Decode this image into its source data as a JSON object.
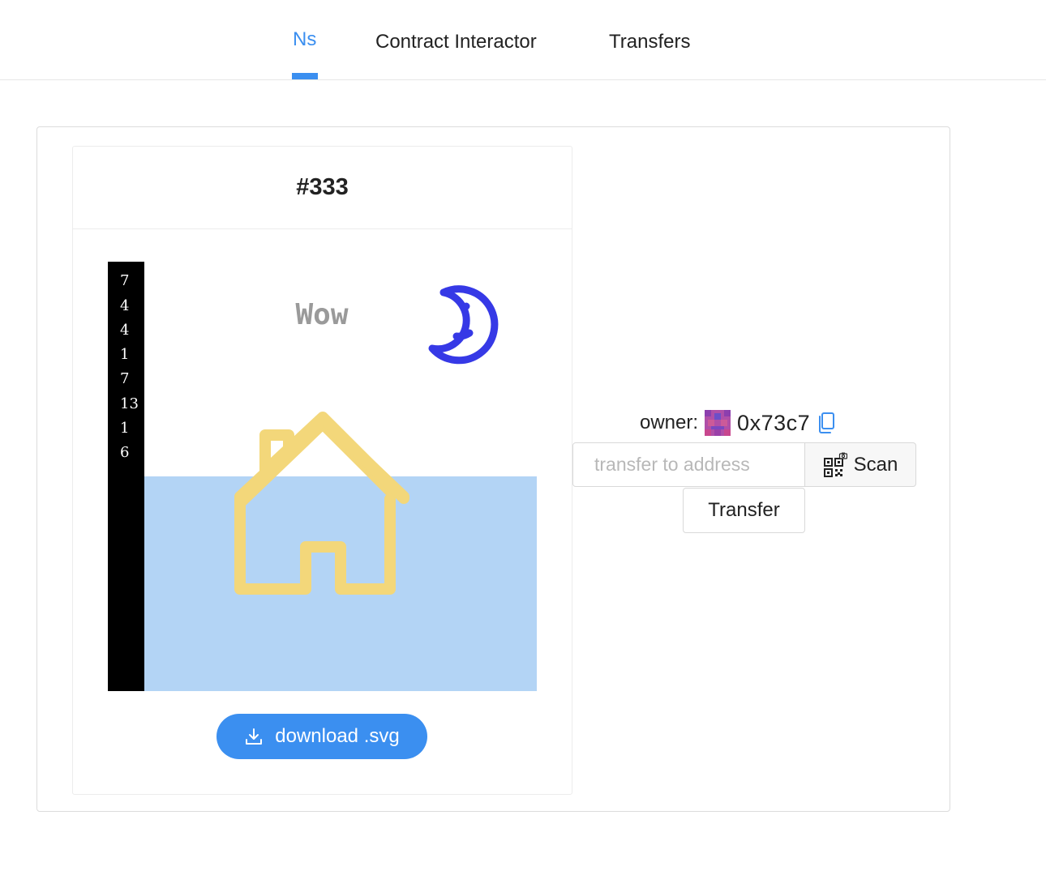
{
  "tabs": [
    {
      "label": "Ns",
      "active": true
    },
    {
      "label": "Contract Interactor",
      "active": false
    },
    {
      "label": "Transfers",
      "active": false
    }
  ],
  "card": {
    "title": "#333",
    "art": {
      "numbers": [
        "7",
        "4",
        "4",
        "1",
        "7",
        "13",
        "1",
        "6"
      ],
      "caption": "Wow",
      "colors": {
        "strip": "#000000",
        "water": "#b3d4f5",
        "house": "#f3d77a",
        "moon": "#3639e6",
        "caption": "#9a9a9a"
      }
    },
    "download_label": "download .svg",
    "download_icon": "download-icon"
  },
  "owner": {
    "label": "owner:",
    "address": "0x73c7",
    "copy_icon": "copy-icon"
  },
  "transfer": {
    "placeholder": "transfer to address",
    "scan_label": "Scan",
    "scan_icon": "qr-scan-icon",
    "button_label": "Transfer"
  },
  "accent": "#3b8ff0"
}
